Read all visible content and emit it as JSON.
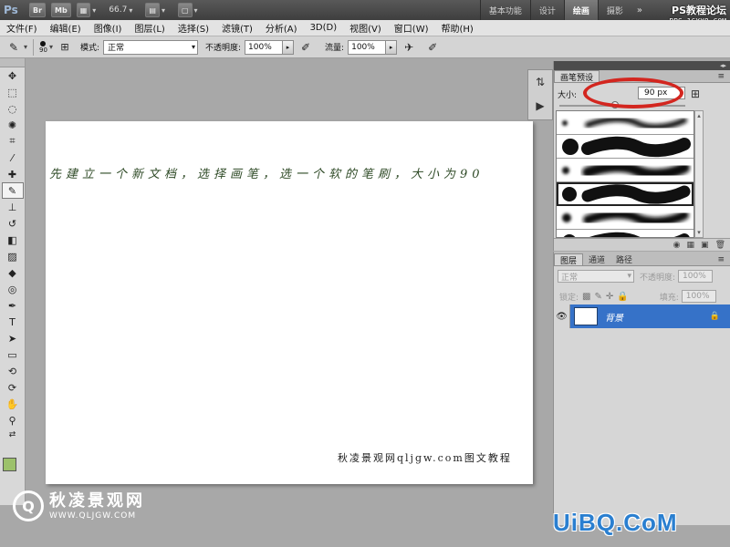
{
  "app": {
    "logo": "Ps",
    "bridge_btn": "Br",
    "minibridge_btn": "Mb",
    "zoom": "66.7",
    "workspaces": [
      "基本功能",
      "设计",
      "绘画",
      "摄影"
    ],
    "active_workspace": "绘画",
    "more": "»"
  },
  "menu": [
    "文件(F)",
    "编辑(E)",
    "图像(I)",
    "图层(L)",
    "选择(S)",
    "滤镜(T)",
    "分析(A)",
    "3D(D)",
    "视图(V)",
    "窗口(W)",
    "帮助(H)"
  ],
  "options": {
    "brush_size": "90",
    "mode_label": "模式:",
    "mode_value": "正常",
    "opacity_label": "不透明度:",
    "opacity_value": "100%",
    "flow_label": "流量:",
    "flow_value": "100%"
  },
  "brush_panel": {
    "tabs": [
      "画笔预设"
    ],
    "size_label": "大小:",
    "size_value": "90 px",
    "size_fraction": 0.44,
    "strokes": [
      {
        "dot": 6,
        "width": 6,
        "soft": true
      },
      {
        "dot": 18,
        "width": 14,
        "soft": false
      },
      {
        "dot": 8,
        "width": 12,
        "soft": true
      },
      {
        "dot": 16,
        "width": 13,
        "soft": false
      },
      {
        "dot": 10,
        "width": 10,
        "soft": true
      },
      {
        "dot": 16,
        "width": 12,
        "soft": false
      }
    ]
  },
  "layers_panel": {
    "tabs": [
      "图层",
      "通道",
      "路径"
    ],
    "blend_mode": "正常",
    "opacity_label": "不透明度:",
    "opacity_value": "100%",
    "lock_label": "锁定:",
    "fill_label": "填充:",
    "fill_value": "100%",
    "layer_name": "背景"
  },
  "document": {
    "instruction": "先建立一个新文档，选择画笔，选一个软的笔刷，大小为90",
    "credit": "秋凌景观网qljgw.com图文教程"
  },
  "watermarks": {
    "left_logo": "Q",
    "left_title": "秋凌景观网",
    "left_url": "WWW.QLJGW.COM",
    "bottom_right": "UiBQ.CoM",
    "top_right_1": "PS教程论坛",
    "top_right_2": "BBS.16XX8.COM"
  },
  "colors": {
    "foreground": "#9cc16b",
    "highlight_oval": "#d3261f",
    "selected_layer": "#3672c8"
  }
}
